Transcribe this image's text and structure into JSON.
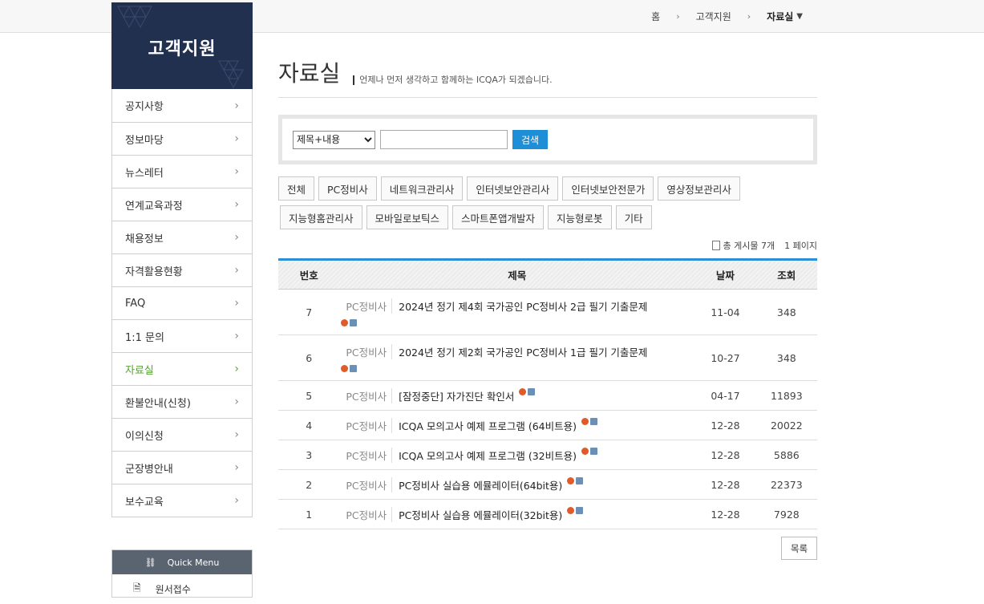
{
  "breadcrumb": {
    "home": "홈",
    "level1": "고객지원",
    "current": "자료실"
  },
  "sidebar": {
    "title": "고객지원",
    "items": [
      {
        "label": "공지사항"
      },
      {
        "label": "정보마당"
      },
      {
        "label": "뉴스레터"
      },
      {
        "label": "연계교육과정"
      },
      {
        "label": "채용정보"
      },
      {
        "label": "자격활용현황"
      },
      {
        "label": "FAQ"
      },
      {
        "label": "1:1 문의"
      },
      {
        "label": "자료실"
      },
      {
        "label": "환불안내(신청)"
      },
      {
        "label": "이의신청"
      },
      {
        "label": "군장병안내"
      },
      {
        "label": "보수교육"
      }
    ],
    "quick_menu": {
      "header": "Quick Menu",
      "first_item": "원서접수"
    }
  },
  "page": {
    "title": "자료실",
    "subtitle": "언제나 먼저 생각하고 함께하는 ICQA가 되겠습니다."
  },
  "search": {
    "select_value": "제목+내용",
    "button": "검색"
  },
  "categories": {
    "row1": [
      "전체",
      "PC정비사",
      "네트워크관리사",
      "인터넷보안관리사",
      "인터넷보안전문가",
      "영상정보관리사"
    ],
    "row2": [
      "지능형홈관리사",
      "모바일로보틱스",
      "스마트폰앱개발자",
      "지능형로봇",
      "기타"
    ]
  },
  "count": {
    "total": "총 게시물 7개",
    "pages": "1 페이지"
  },
  "table": {
    "headers": {
      "no": "번호",
      "title": "제목",
      "date": "날짜",
      "views": "조회"
    },
    "rows": [
      {
        "no": "7",
        "cat": "PC정비사",
        "title": "2024년 정기 제4회 국가공인 PC정비사 2급 필기 기출문제",
        "date": "11-04",
        "views": "348"
      },
      {
        "no": "6",
        "cat": "PC정비사",
        "title": "2024년 정기 제2회 국가공인 PC정비사 1급 필기 기출문제",
        "date": "10-27",
        "views": "348"
      },
      {
        "no": "5",
        "cat": "PC정비사",
        "title": "[잠정중단] 자가진단 확인서",
        "date": "04-17",
        "views": "11893"
      },
      {
        "no": "4",
        "cat": "PC정비사",
        "title": "ICQA 모의고사 예제 프로그램 (64비트용)",
        "date": "12-28",
        "views": "20022"
      },
      {
        "no": "3",
        "cat": "PC정비사",
        "title": "ICQA 모의고사 예제 프로그램 (32비트용)",
        "date": "12-28",
        "views": "5886"
      },
      {
        "no": "2",
        "cat": "PC정비사",
        "title": "PC정비사 실습용 에뮬레이터(64bit용)",
        "date": "12-28",
        "views": "22373"
      },
      {
        "no": "1",
        "cat": "PC정비사",
        "title": "PC정비사 실습용 에뮬레이터(32bit용)",
        "date": "12-28",
        "views": "7928"
      }
    ]
  },
  "list_button": "목록",
  "colors": {
    "sidebar_head": "#22304f",
    "accent_blue": "#2a90d3",
    "active_green": "#55a630"
  }
}
